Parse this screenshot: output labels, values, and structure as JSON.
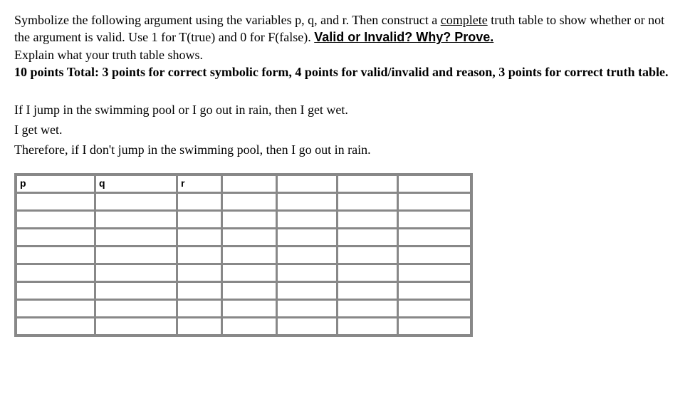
{
  "instructions": {
    "line1_part1": "Symbolize the following argument using the variables p, q, and r.  Then construct a ",
    "line1_underlined": "complete",
    "line1_part2": " truth table to show whether or not the argument is valid.  Use 1 for T(true) and 0 for F(false).   ",
    "valid_invalid": "Valid or Invalid?  Why? Prove.",
    "line3": "Explain what your truth table shows.",
    "points": "10 points Total:  3 points for correct symbolic form, 4 points for valid/invalid and reason, 3 points for correct truth table."
  },
  "argument": {
    "premise1": "If I jump in the swimming pool or I go out in rain, then I get wet.",
    "premise2": "I get wet.",
    "conclusion": "Therefore, if I don't jump in the swimming pool, then I go out in rain."
  },
  "table": {
    "headers": [
      "p",
      "q",
      "r",
      "",
      "",
      "",
      ""
    ],
    "rows": 8
  }
}
